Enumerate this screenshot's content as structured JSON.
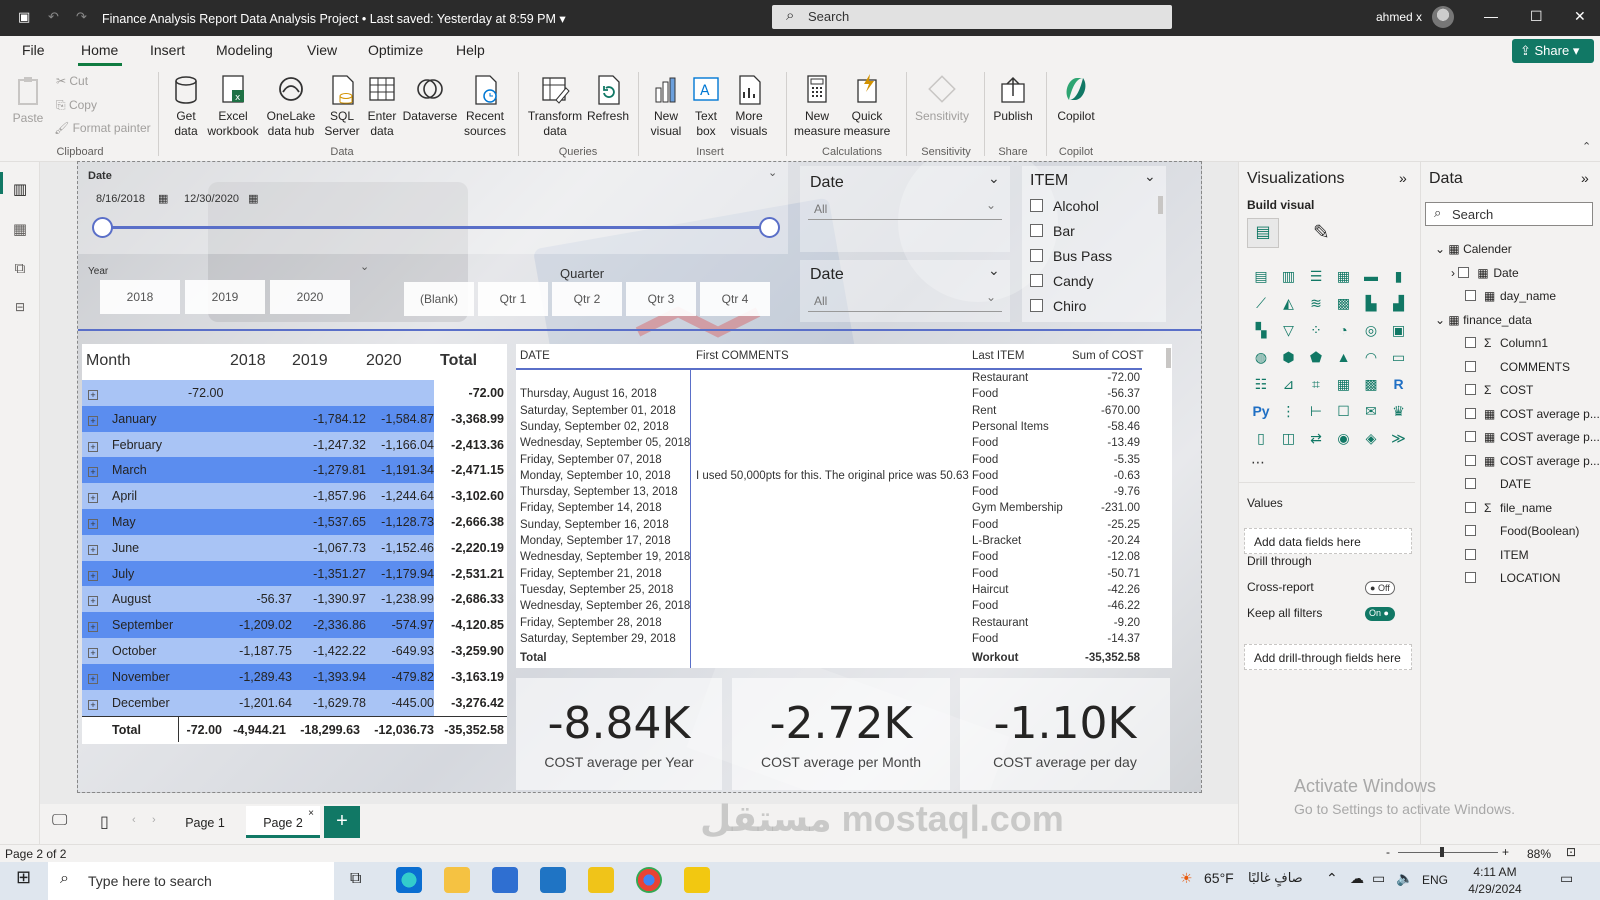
{
  "titlebar": {
    "title": "Finance Analysis Report Data Analysis Project",
    "saved": "Last saved: Yesterday at 8:59 PM",
    "search_placeholder": "Search",
    "user": "ahmed x"
  },
  "menu": [
    "File",
    "Home",
    "Insert",
    "Modeling",
    "View",
    "Optimize",
    "Help"
  ],
  "share_label": "Share",
  "ribbon": {
    "clipboard": {
      "paste": "Paste",
      "cut": "Cut",
      "copy": "Copy",
      "format_painter": "Format painter",
      "group": "Clipboard"
    },
    "data": {
      "get_data": "Get\ndata",
      "excel": "Excel\nworkbook",
      "onelake": "OneLake\ndata hub",
      "sql": "SQL\nServer",
      "enter": "Enter\ndata",
      "dataverse": "Dataverse",
      "recent": "Recent\nsources",
      "group": "Data"
    },
    "queries": {
      "transform": "Transform\ndata",
      "refresh": "Refresh",
      "group": "Queries"
    },
    "insert": {
      "new_visual": "New\nvisual",
      "text_box": "Text\nbox",
      "more_visuals": "More\nvisuals",
      "group": "Insert"
    },
    "calculations": {
      "new_measure": "New\nmeasure",
      "quick_measure": "Quick\nmeasure",
      "group": "Calculations"
    },
    "sensitivity": {
      "label": "Sensitivity",
      "group": "Sensitivity"
    },
    "share": {
      "publish": "Publish",
      "group": "Share"
    },
    "copilot": {
      "label": "Copilot",
      "group": "Copilot"
    }
  },
  "slicers": {
    "date": {
      "label": "Date",
      "start": "8/16/2018",
      "end": "12/30/2020",
      "fill": 1.0
    },
    "year": {
      "label": "Year",
      "options": [
        "2018",
        "2019",
        "2020"
      ]
    },
    "quarter": {
      "label": "Quarter",
      "options": [
        "(Blank)",
        "Qtr 1",
        "Qtr 2",
        "Qtr 3",
        "Qtr 4"
      ]
    },
    "date_dd1": {
      "label": "Date",
      "value": "All"
    },
    "date_dd2": {
      "label": "Date",
      "value": "All"
    },
    "item": {
      "label": "ITEM",
      "options": [
        "Alcohol",
        "Bar",
        "Bus Pass",
        "Candy",
        "Chiro"
      ]
    }
  },
  "matrix": {
    "headers": [
      "Month",
      "2018",
      "2019",
      "2020",
      "Total"
    ],
    "rows": [
      {
        "name": "",
        "y2018": "-72.00",
        "y2019": "",
        "y2020": "",
        "total": "-72.00"
      },
      {
        "name": "January",
        "y2018": "",
        "y2019": "-1,784.12",
        "y2020": "-1,584.87",
        "total": "-3,368.99"
      },
      {
        "name": "February",
        "y2018": "",
        "y2019": "-1,247.32",
        "y2020": "-1,166.04",
        "total": "-2,413.36"
      },
      {
        "name": "March",
        "y2018": "",
        "y2019": "-1,279.81",
        "y2020": "-1,191.34",
        "total": "-2,471.15"
      },
      {
        "name": "April",
        "y2018": "",
        "y2019": "-1,857.96",
        "y2020": "-1,244.64",
        "total": "-3,102.60"
      },
      {
        "name": "May",
        "y2018": "",
        "y2019": "-1,537.65",
        "y2020": "-1,128.73",
        "total": "-2,666.38"
      },
      {
        "name": "June",
        "y2018": "",
        "y2019": "-1,067.73",
        "y2020": "-1,152.46",
        "total": "-2,220.19"
      },
      {
        "name": "July",
        "y2018": "",
        "y2019": "-1,351.27",
        "y2020": "-1,179.94",
        "total": "-2,531.21"
      },
      {
        "name": "August",
        "y2018": "-56.37",
        "y2019": "-1,390.97",
        "y2020": "-1,238.99",
        "total": "-2,686.33"
      },
      {
        "name": "September",
        "y2018": "-1,209.02",
        "y2019": "-2,336.86",
        "y2020": "-574.97",
        "total": "-4,120.85"
      },
      {
        "name": "October",
        "y2018": "-1,187.75",
        "y2019": "-1,422.22",
        "y2020": "-649.93",
        "total": "-3,259.90"
      },
      {
        "name": "November",
        "y2018": "-1,289.43",
        "y2019": "-1,393.94",
        "y2020": "-479.82",
        "total": "-3,163.19"
      },
      {
        "name": "December",
        "y2018": "-1,201.64",
        "y2019": "-1,629.78",
        "y2020": "-445.00",
        "total": "-3,276.42"
      }
    ],
    "total_row": {
      "name": "Total",
      "y2018": "-72.00",
      "y2019": "-4,944.21",
      "y2020": "-18,299.63",
      "y2020b": "-12,036.73",
      "total": "-35,352.58"
    }
  },
  "table": {
    "headers": [
      "DATE",
      "First COMMENTS",
      "Last ITEM",
      "Sum of COST"
    ],
    "rows": [
      {
        "date": "",
        "comment": "",
        "item": "Restaurant",
        "cost": "-72.00"
      },
      {
        "date": "Thursday, August 16, 2018",
        "comment": "",
        "item": "Food",
        "cost": "-56.37"
      },
      {
        "date": "Saturday, September 01, 2018",
        "comment": "",
        "item": "Rent",
        "cost": "-670.00"
      },
      {
        "date": "Sunday, September 02, 2018",
        "comment": "",
        "item": "Personal Items",
        "cost": "-58.46"
      },
      {
        "date": "Wednesday, September 05, 2018",
        "comment": "",
        "item": "Food",
        "cost": "-13.49"
      },
      {
        "date": "Friday, September 07, 2018",
        "comment": "",
        "item": "Food",
        "cost": "-5.35"
      },
      {
        "date": "Monday, September 10, 2018",
        "comment": "I used 50,000pts for this. The original price was 50.63",
        "item": "Food",
        "cost": "-0.63"
      },
      {
        "date": "Thursday, September 13, 2018",
        "comment": "",
        "item": "Food",
        "cost": "-9.76"
      },
      {
        "date": "Friday, September 14, 2018",
        "comment": "",
        "item": "Gym Membership",
        "cost": "-231.00"
      },
      {
        "date": "Sunday, September 16, 2018",
        "comment": "",
        "item": "Food",
        "cost": "-25.25"
      },
      {
        "date": "Monday, September 17, 2018",
        "comment": "",
        "item": "L-Bracket",
        "cost": "-20.24"
      },
      {
        "date": "Wednesday, September 19, 2018",
        "comment": "",
        "item": "Food",
        "cost": "-12.08"
      },
      {
        "date": "Friday, September 21, 2018",
        "comment": "",
        "item": "Food",
        "cost": "-50.71"
      },
      {
        "date": "Tuesday, September 25, 2018",
        "comment": "",
        "item": "Haircut",
        "cost": "-42.26"
      },
      {
        "date": "Wednesday, September 26, 2018",
        "comment": "",
        "item": "Food",
        "cost": "-46.22"
      },
      {
        "date": "Friday, September 28, 2018",
        "comment": "",
        "item": "Restaurant",
        "cost": "-9.20"
      },
      {
        "date": "Saturday, September 29, 2018",
        "comment": "",
        "item": "Food",
        "cost": "-14.37"
      }
    ],
    "total": {
      "label": "Total",
      "item": "Workout",
      "cost": "-35,352.58"
    }
  },
  "cards": [
    {
      "value": "-8.84K",
      "label": "COST average per Year"
    },
    {
      "value": "-2.72K",
      "label": "COST average per Month"
    },
    {
      "value": "-1.10K",
      "label": "COST average per day"
    }
  ],
  "viz": {
    "title": "Visualizations",
    "build": "Build visual",
    "values": "Values",
    "values_well": "Add data fields here",
    "drill": "Drill through",
    "cross_report": "Cross-report",
    "cross_state": "Off",
    "keep_filters": "Keep all filters",
    "keep_state": "On",
    "drill_well": "Add drill-through fields here"
  },
  "data_pane": {
    "title": "Data",
    "search": "Search",
    "tables": [
      {
        "name": "Calender",
        "fields": [
          "Date",
          "day_name"
        ]
      },
      {
        "name": "finance_data",
        "fields": [
          "Column1",
          "COMMENTS",
          "COST",
          "COST average p...",
          "COST average p...",
          "COST average p...",
          "DATE",
          "file_name",
          "Food(Boolean)",
          "ITEM",
          "LOCATION"
        ]
      }
    ]
  },
  "pages": {
    "tabs": [
      "Page 1",
      "Page 2"
    ],
    "add": "+"
  },
  "status": {
    "page": "Page 2 of 2",
    "zoom": "88%"
  },
  "activate": {
    "line1": "Activate Windows",
    "line2": "Go to Settings to activate Windows."
  },
  "taskbar": {
    "search": "Type here to search",
    "weather": "65°F",
    "weather_text": "صافٍ غالبًا",
    "lang": "ENG",
    "time": "4:11 AM",
    "date": "4/29/2024"
  },
  "watermark": "مستقل mostaql.com",
  "colors": {
    "accent": "#117865",
    "matrix_dark": "#5b8def",
    "matrix_light": "#a9c4f5",
    "slider": "#5a6fc8"
  }
}
